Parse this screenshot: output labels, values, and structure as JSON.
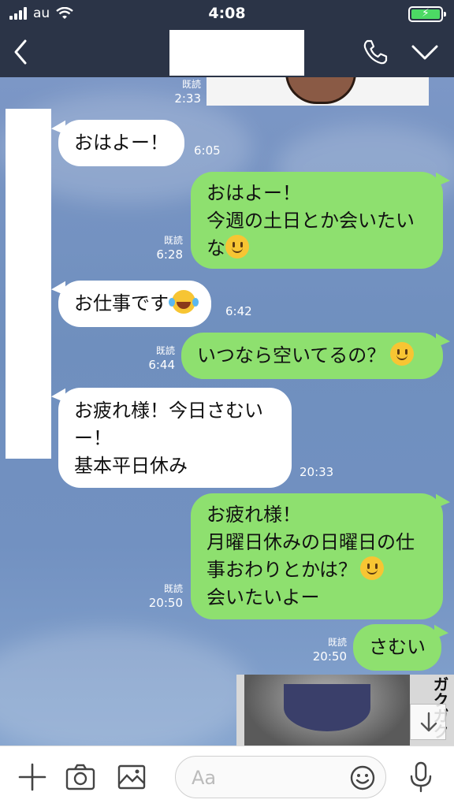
{
  "status": {
    "carrier": "au",
    "time": "4:08",
    "battery_color": "#4cd964"
  },
  "header": {
    "back_icon": "chevron-left-icon",
    "call_icon": "phone-icon",
    "menu_icon": "chevron-down-icon"
  },
  "messages": [
    {
      "dir": "out",
      "read": "既読",
      "time": "2:33"
    },
    {
      "dir": "in",
      "text": "おはよー！",
      "time": "6:05"
    },
    {
      "dir": "out",
      "lines": [
        "おはよー！",
        "今週の土日とか会いたい",
        "な"
      ],
      "read": "既読",
      "time": "6:28"
    },
    {
      "dir": "in",
      "text": "お仕事です",
      "time": "6:42"
    },
    {
      "dir": "out",
      "text": "いつなら空いてるの？",
      "read": "既読",
      "time": "6:44"
    },
    {
      "dir": "in",
      "lines": [
        "お疲れ様！今日さむい",
        "ー！",
        "基本平日休み"
      ],
      "time": "20:33"
    },
    {
      "dir": "out",
      "lines": [
        "お疲れ様！",
        "月曜日休みの日曜日の仕",
        "事おわりとかは？",
        "会いたいよー"
      ],
      "read": "既読",
      "time": "20:50"
    },
    {
      "dir": "out",
      "text": "さむい",
      "read": "既読",
      "time": "20:50"
    }
  ],
  "sticker": {
    "sfx": "ガクガク"
  },
  "input": {
    "placeholder": "Aa"
  },
  "colors": {
    "header": "#2b3447",
    "outgoing_bubble": "#8ee06f",
    "incoming_bubble": "#ffffff"
  }
}
